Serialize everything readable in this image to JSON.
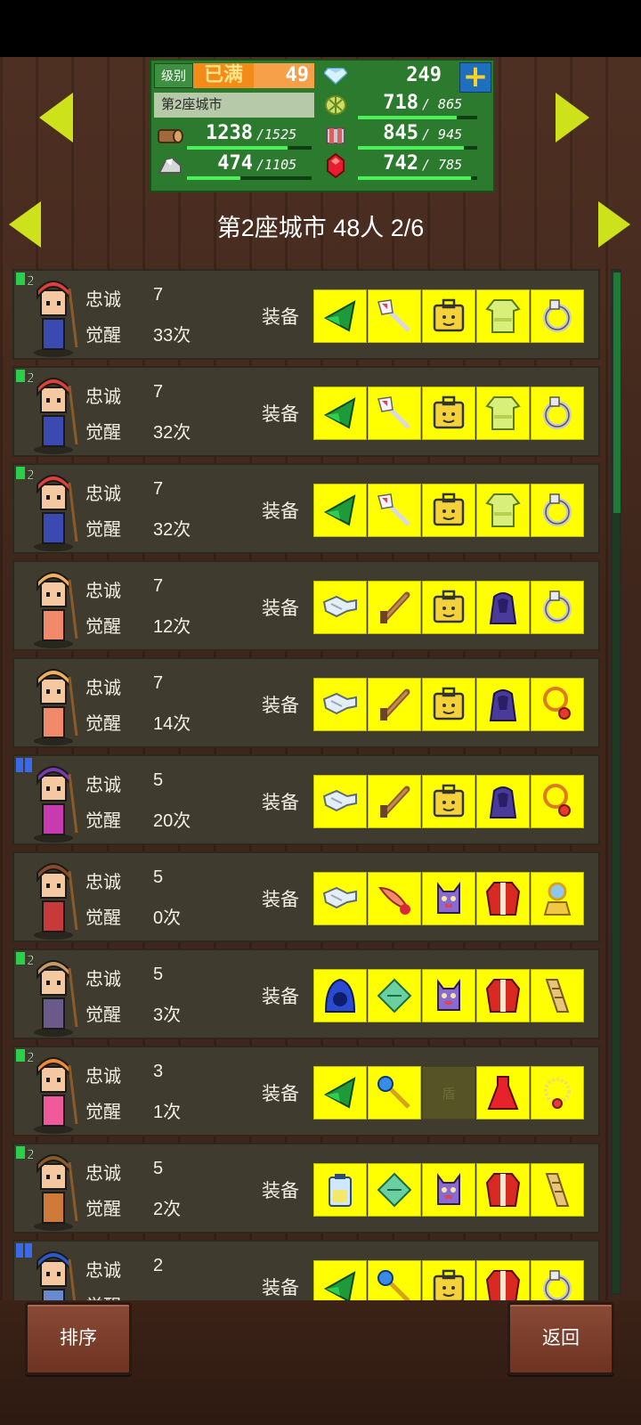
{
  "status": {
    "level_tag": "级别",
    "level_max": "已满",
    "level": "49",
    "gems": "249",
    "city_name": "第2座城市",
    "wood": {
      "value": "1238",
      "max": "/1525",
      "fraction": 0.81
    },
    "ore": {
      "value": "474",
      "max": "/1105",
      "fraction": 0.43
    },
    "food": {
      "value": "718",
      "max": "/ 865",
      "fraction": 0.83
    },
    "fabric": {
      "value": "845",
      "max": "/ 945",
      "fraction": 0.89
    },
    "ruby": {
      "value": "742",
      "max": "/ 785",
      "fraction": 0.95
    }
  },
  "header": {
    "title": "第2座城市  48人 2/6"
  },
  "labels": {
    "loyalty": "忠诚",
    "awaken": "觉醒",
    "equip": "装备"
  },
  "rows": [
    {
      "loyalty": "7",
      "awaken": "33次",
      "rank": "2",
      "slots": [
        "green-hat",
        "crystal-staff",
        "bag",
        "green-robe",
        "ring"
      ]
    },
    {
      "loyalty": "7",
      "awaken": "32次",
      "rank": "2",
      "slots": [
        "green-hat",
        "crystal-staff",
        "bag",
        "green-robe",
        "ring"
      ]
    },
    {
      "loyalty": "7",
      "awaken": "32次",
      "rank": "2",
      "slots": [
        "green-hat",
        "crystal-staff",
        "bag",
        "green-robe",
        "ring"
      ]
    },
    {
      "loyalty": "7",
      "awaken": "12次",
      "rank": "",
      "slots": [
        "silver-gauntlet",
        "wooden-gun",
        "bag",
        "purple-cloak",
        "ring"
      ]
    },
    {
      "loyalty": "7",
      "awaken": "14次",
      "rank": "",
      "slots": [
        "silver-gauntlet",
        "wooden-gun",
        "bag",
        "purple-cloak",
        "amulet"
      ]
    },
    {
      "loyalty": "5",
      "awaken": "20次",
      "rank": "blue",
      "slots": [
        "silver-gauntlet",
        "wooden-gun",
        "bag",
        "purple-cloak",
        "amulet"
      ]
    },
    {
      "loyalty": "5",
      "awaken": "0次",
      "rank": "",
      "slots": [
        "silver-gauntlet",
        "red-feather",
        "cat-mask",
        "red-coat",
        "gold-charm"
      ]
    },
    {
      "loyalty": "5",
      "awaken": "3次",
      "rank": "2",
      "slots": [
        "blue-hood",
        "green-card",
        "cat-mask",
        "red-coat",
        "scroll"
      ]
    },
    {
      "loyalty": "3",
      "awaken": "1次",
      "rank": "2",
      "slots": [
        "green-hat",
        "blue-wand",
        "empty",
        "red-dress",
        "gold-necklace"
      ]
    },
    {
      "loyalty": "5",
      "awaken": "2次",
      "rank": "2",
      "slots": [
        "potion",
        "green-card",
        "cat-mask",
        "red-coat",
        "scroll"
      ]
    },
    {
      "loyalty": "2",
      "awaken": "",
      "rank": "blue",
      "slots": [
        "green-hat",
        "blue-wand",
        "bag",
        "red-coat",
        "ring"
      ]
    }
  ],
  "empty_slot_label": "盾",
  "buttons": {
    "sort": "排序",
    "back": "返回"
  },
  "colors": {
    "slot": "#ffff00",
    "arrow": "#cde21b",
    "panel": "#2b7a2e"
  }
}
